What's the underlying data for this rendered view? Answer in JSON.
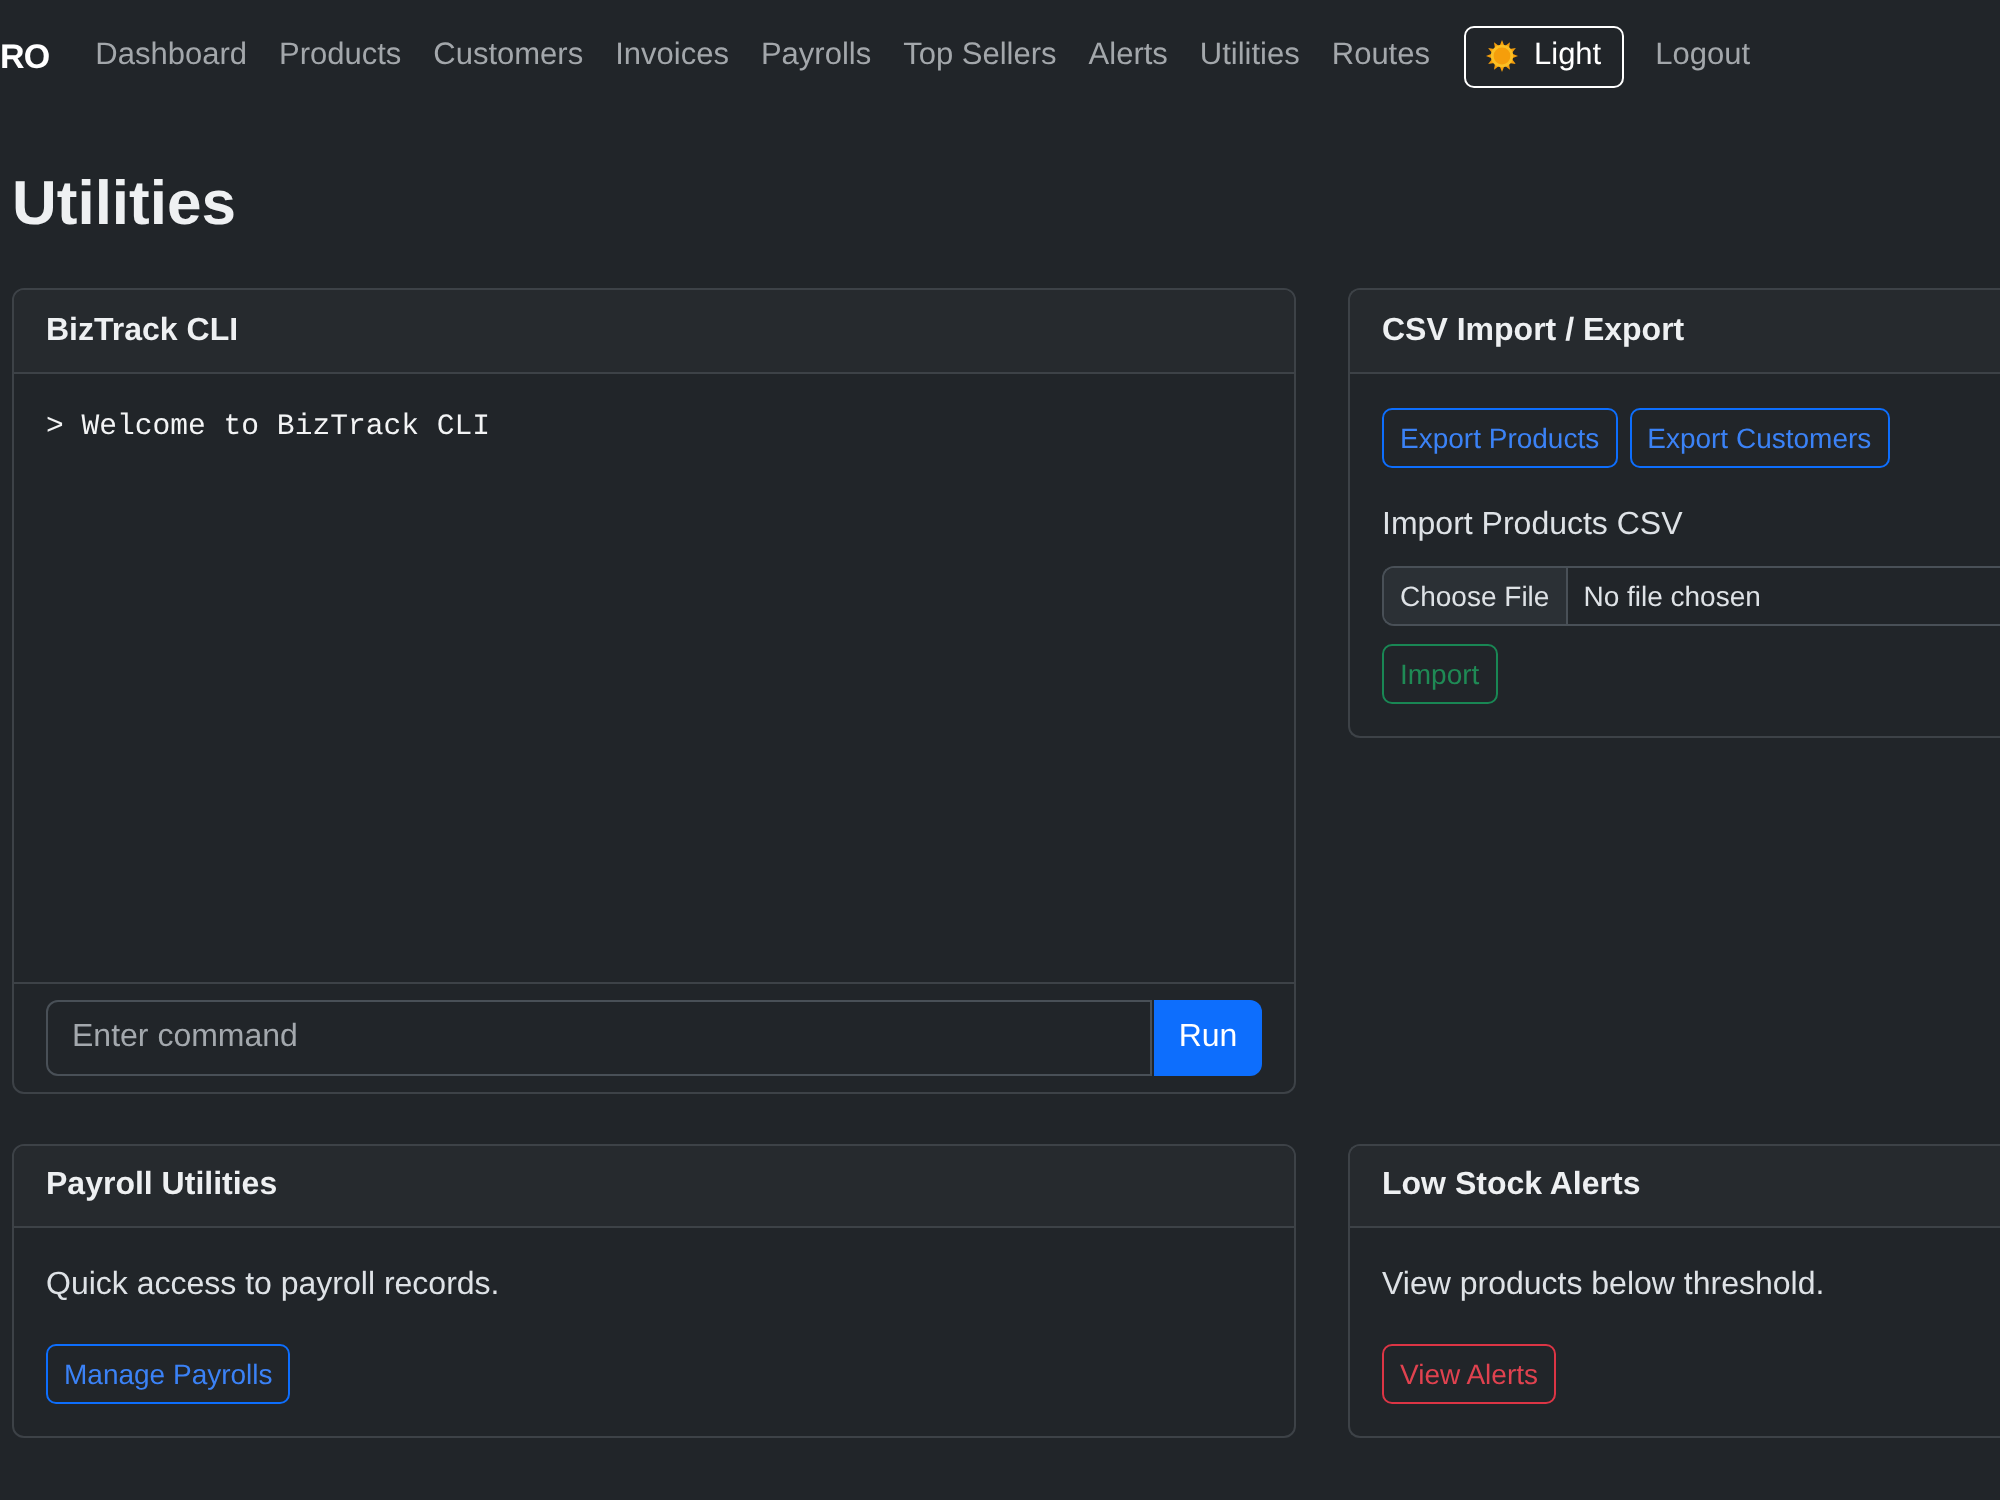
{
  "navbar": {
    "brand": "RO",
    "links": [
      "Dashboard",
      "Products",
      "Customers",
      "Invoices",
      "Payrolls",
      "Top Sellers",
      "Alerts",
      "Utilities",
      "Routes"
    ],
    "theme_button": {
      "label": "Light"
    },
    "logout": "Logout"
  },
  "page_title": "Utilities",
  "cli_panel": {
    "title": "BizTrack CLI",
    "output": [
      "> Welcome to BizTrack CLI"
    ],
    "command_field": {
      "placeholder": "Enter command"
    },
    "run_button": "Run"
  },
  "csv_panel": {
    "title": "CSV Import / Export",
    "export_buttons": [
      "Export Products",
      "Export Customers"
    ],
    "import_label": "Import Products CSV",
    "file_field": {
      "button": "Choose File",
      "status": "No file chosen"
    },
    "import_button": "Import"
  },
  "shortcut_panels": [
    {
      "title": "Payroll Utilities",
      "text": "Quick access to payroll records.",
      "button": "Manage Payrolls"
    },
    {
      "title": "Low Stock Alerts",
      "text": "View products below threshold.",
      "button": "View Alerts"
    }
  ]
}
